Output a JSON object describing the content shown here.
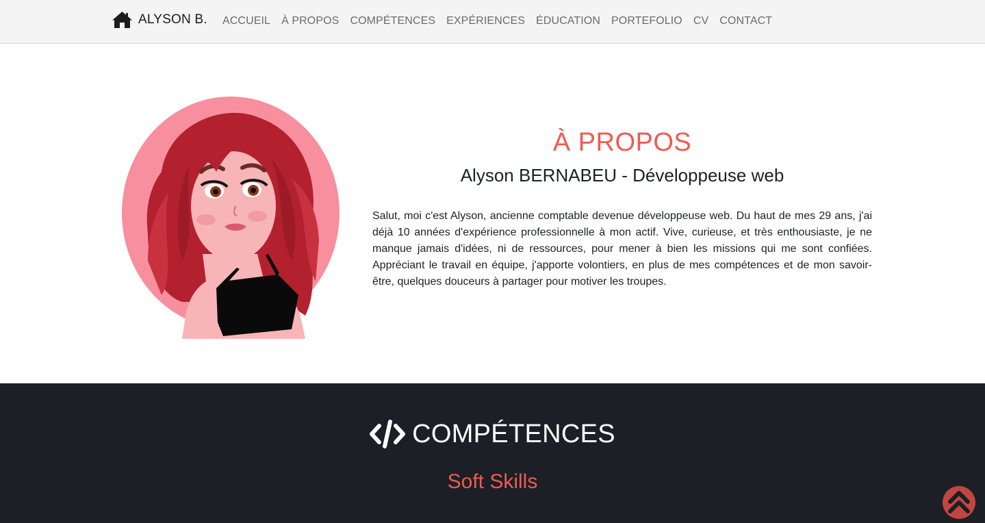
{
  "navbar": {
    "brand_icon": "home-icon",
    "brand_text": "ALYSON B.",
    "links": [
      "ACCUEIL",
      "À PROPOS",
      "COMPÉTENCES",
      "EXPÉRIENCES",
      "ÉDUCATION",
      "PORTEFOLIO",
      "CV",
      "CONTACT"
    ]
  },
  "about": {
    "avatar_icon": "avatar-illustration",
    "title": "À PROPOS",
    "subtitle": "Alyson BERNABEU - Développeuse web",
    "text": "Salut, moi c'est Alyson, ancienne comptable devenue développeuse web. Du haut de mes 29 ans, j'ai déjà 10 années d'expérience professionnelle à mon actif. Vive, curieuse, et très enthousiaste, je ne manque jamais d'idées, ni de ressources, pour mener à bien les missions qui me sont confiées. Appréciant le travail en équipe, j'apporte volontiers, en plus de mes compétences et de mon savoir-être, quelques douceurs à partager pour motiver les troupes."
  },
  "skills": {
    "icon": "code-icon",
    "title": "COMPÉTENCES",
    "subtitle": "Soft Skills"
  },
  "back_to_top": {
    "icon": "double-chevron-up-icon"
  },
  "colors": {
    "accent": "#ef5a52",
    "dark_bg": "#1c1f26",
    "navbar_bg": "#f4f4f5",
    "avatar_bg": "#f78f9e",
    "hair": "#b3212e"
  }
}
